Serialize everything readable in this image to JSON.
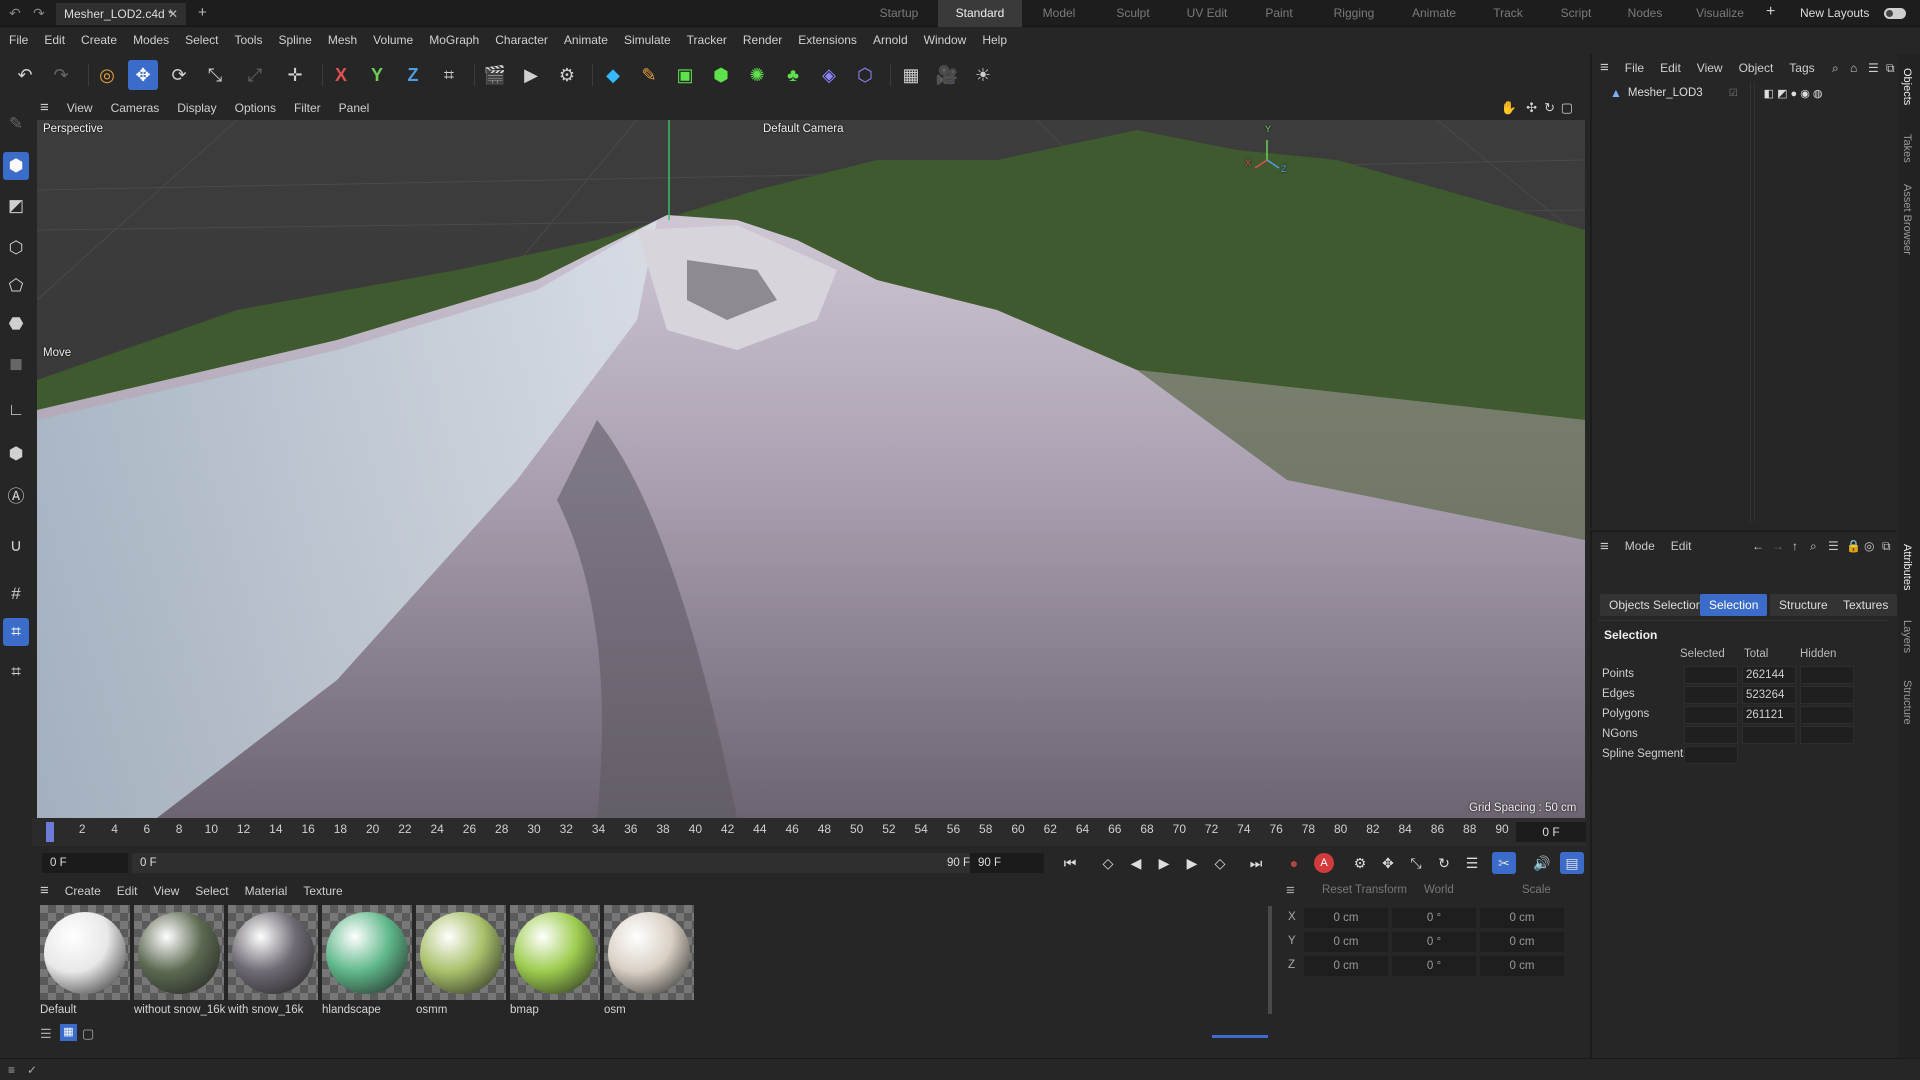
{
  "titlebar": {
    "doc_tab": "Mesher_LOD2.c4d *",
    "layouts": [
      "Startup",
      "Standard",
      "Model",
      "Sculpt",
      "UV Edit",
      "Paint",
      "Rigging",
      "Animate",
      "Track",
      "Script",
      "Nodes",
      "Visualize"
    ],
    "active_layout": "Standard",
    "new_layouts": "New Layouts"
  },
  "menubar": [
    "File",
    "Edit",
    "Create",
    "Modes",
    "Select",
    "Tools",
    "Spline",
    "Mesh",
    "Volume",
    "MoGraph",
    "Character",
    "Animate",
    "Simulate",
    "Tracker",
    "Render",
    "Extensions",
    "Arnold",
    "Window",
    "Help"
  ],
  "toolbar": {
    "axis_x": "X",
    "axis_y": "Y",
    "axis_z": "Z"
  },
  "viewport": {
    "menu": [
      "View",
      "Cameras",
      "Display",
      "Options",
      "Filter",
      "Panel"
    ],
    "projection": "Perspective",
    "camera": "Default Camera",
    "tool_label": "Move",
    "grid_spacing": "Grid Spacing : 50 cm",
    "gizmo": {
      "x": "X",
      "y": "Y",
      "z": "Z"
    }
  },
  "timeline": {
    "ticks": [
      "0",
      "2",
      "4",
      "6",
      "8",
      "10",
      "12",
      "14",
      "16",
      "18",
      "20",
      "22",
      "24",
      "26",
      "28",
      "30",
      "32",
      "34",
      "36",
      "38",
      "40",
      "42",
      "44",
      "46",
      "48",
      "50",
      "52",
      "54",
      "56",
      "58",
      "60",
      "62",
      "64",
      "66",
      "68",
      "70",
      "72",
      "74",
      "76",
      "78",
      "80",
      "82",
      "84",
      "86",
      "88",
      "90"
    ],
    "current_frame": "0 F",
    "start_field": "0 F",
    "range_start": "0 F",
    "range_end": "90 F",
    "end_field": "90 F",
    "record_label": "A"
  },
  "materials": {
    "menu": [
      "Create",
      "Edit",
      "View",
      "Select",
      "Material",
      "Texture"
    ],
    "items": [
      {
        "name": "Default",
        "color": "#e8e8e8"
      },
      {
        "name": "without snow_16k",
        "color": "#5d6a52"
      },
      {
        "name": "with snow_16k",
        "color": "#6f6a74"
      },
      {
        "name": "hlandscape",
        "color": "#5fb88a"
      },
      {
        "name": "osmm",
        "color": "#a8c06a"
      },
      {
        "name": "bmap",
        "color": "#9ccc4e"
      },
      {
        "name": "osm",
        "color": "#d9d0c4"
      }
    ]
  },
  "coordinates": {
    "reset": "Reset Transform",
    "space": "World",
    "mode": "Scale",
    "rows": [
      {
        "axis": "X",
        "pos": "0 cm",
        "rot": "0 °",
        "scale": "0 cm"
      },
      {
        "axis": "Y",
        "pos": "0 cm",
        "rot": "0 °",
        "scale": "0 cm"
      },
      {
        "axis": "Z",
        "pos": "0 cm",
        "rot": "0 °",
        "scale": "0 cm"
      }
    ]
  },
  "objects": {
    "menu": [
      "File",
      "Edit",
      "View",
      "Object",
      "Tags"
    ],
    "items": [
      {
        "name": "Mesher_LOD3"
      }
    ]
  },
  "attributes": {
    "menu": [
      "Mode",
      "Edit"
    ],
    "tabs": [
      "Objects Selection",
      "Selection",
      "Structure",
      "Textures"
    ],
    "active_tab": "Selection",
    "section_title": "Selection",
    "columns": [
      "Selected",
      "Total",
      "Hidden"
    ],
    "rows": [
      {
        "label": "Points",
        "total": "262144"
      },
      {
        "label": "Edges",
        "total": "523264"
      },
      {
        "label": "Polygons",
        "total": "261121"
      },
      {
        "label": "NGons",
        "total": ""
      },
      {
        "label": "Spline Segments",
        "total": ""
      }
    ]
  },
  "side_tabs": [
    "Objects",
    "Takes",
    "Asset Browser",
    "Attributes",
    "Layers",
    "Structure"
  ],
  "colors": {
    "accent": "#3b6cc9",
    "background": "#262626"
  }
}
